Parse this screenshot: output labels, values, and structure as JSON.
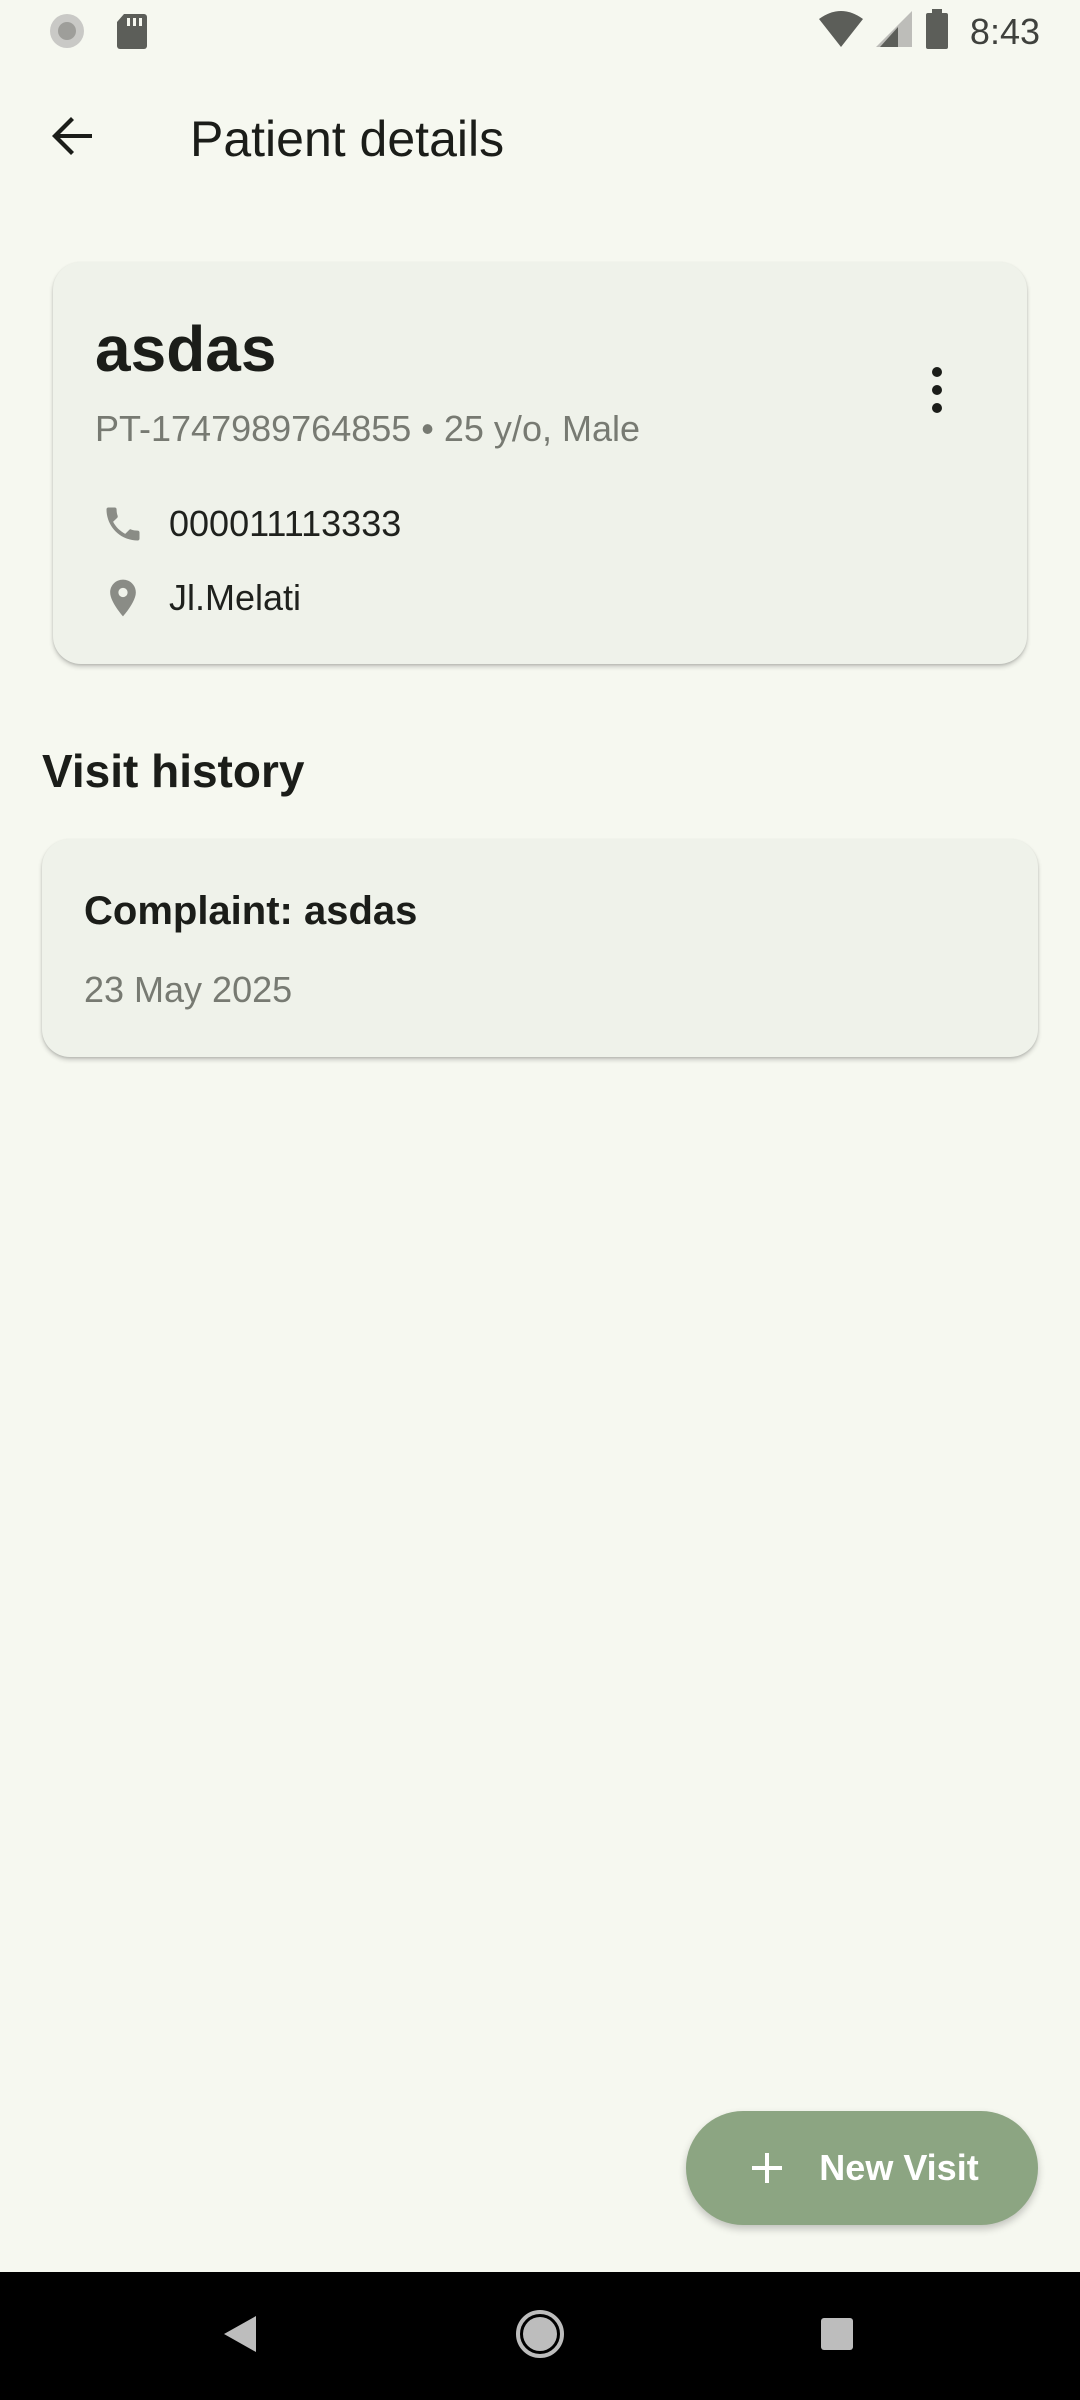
{
  "status_bar": {
    "time": "8:43",
    "left_icons": [
      "settings-spinner-icon",
      "sd-card-icon"
    ],
    "right_icons": [
      "wifi-icon",
      "signal-icon",
      "battery-icon"
    ]
  },
  "header": {
    "title": "Patient details",
    "back_icon": "arrow-back-icon"
  },
  "patient": {
    "name": "asdas",
    "meta": "PT-1747989764855 • 25 y/o, Male",
    "phone": "000011113333",
    "address": "Jl.Melati",
    "menu_icon": "more-vert-icon"
  },
  "visit_history": {
    "title": "Visit history",
    "visits": [
      {
        "complaint": "Complaint: asdas",
        "date": "23 May 2025"
      }
    ]
  },
  "fab": {
    "label": "New Visit",
    "icon": "plus-icon"
  },
  "colors": {
    "background": "#f6f8f0",
    "card": "#eff2ea",
    "fab": "#8ca582",
    "text_primary": "#1b1d19",
    "text_secondary": "#777a72"
  }
}
